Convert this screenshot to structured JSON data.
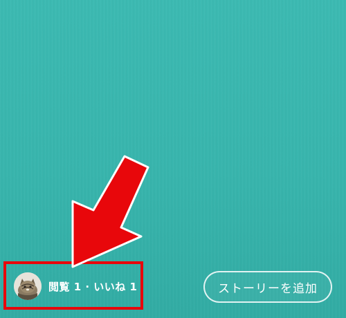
{
  "story_footer": {
    "avatar_icon": "cat-avatar-icon",
    "viewer_stats": "閲覧 1 · いいね 1",
    "add_story_label": "ストーリーを追加"
  },
  "annotation": {
    "highlight_color": "#e8070b",
    "arrow_color": "#e8070b"
  },
  "colors": {
    "background": "#38b5ad",
    "text": "#ffffff"
  }
}
